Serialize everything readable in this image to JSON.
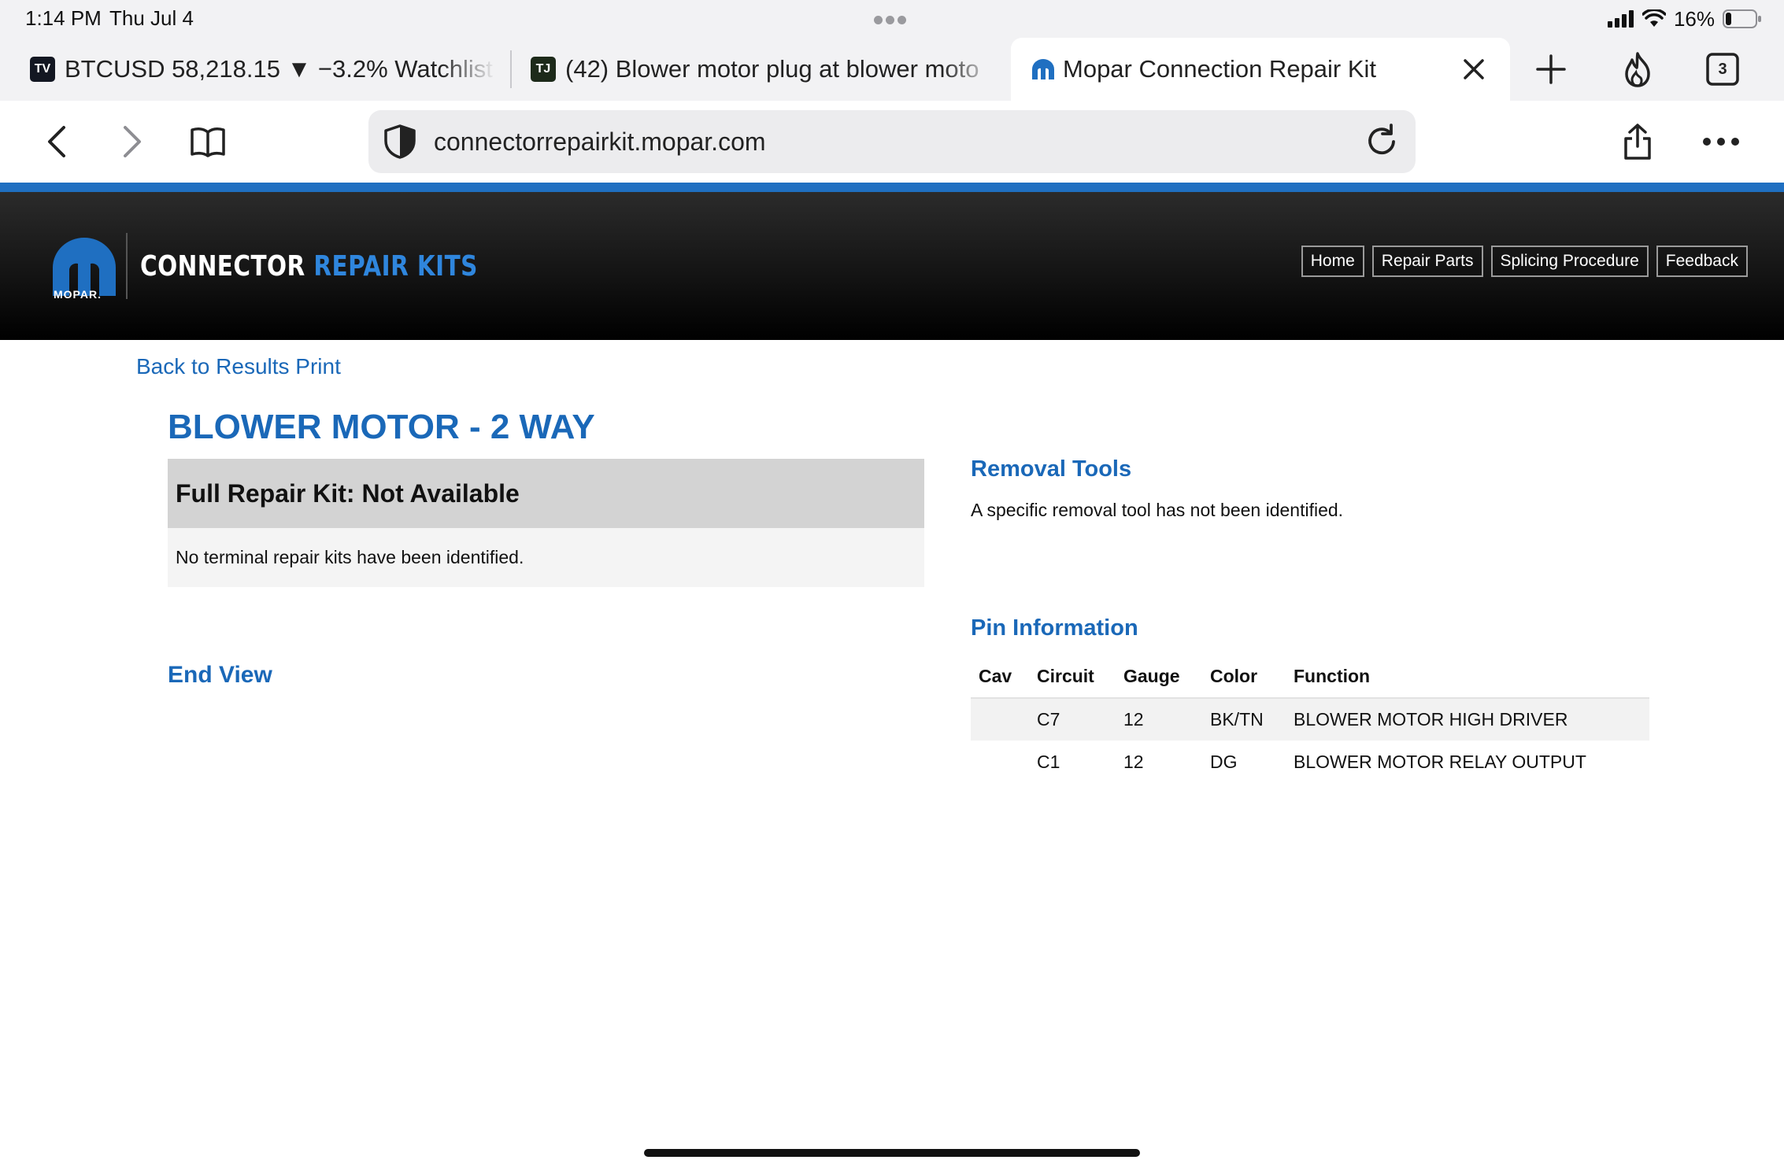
{
  "status_bar": {
    "time": "1:14 PM",
    "date": "Thu Jul 4",
    "battery_percent": "16%",
    "icons": [
      "signal-icon",
      "wifi-icon",
      "battery-icon"
    ]
  },
  "tabs": [
    {
      "favicon": "TV",
      "label": "BTCUSD 58,218.15 ▼ −3.2% Watchlist"
    },
    {
      "favicon": "TJ",
      "label": "(42) Blower motor plug at blower moto"
    },
    {
      "favicon": "mopar-icon",
      "label": "Mopar Connection Repair Kit",
      "active": true
    }
  ],
  "tab_bar": {
    "tab_count": "3",
    "icons": [
      "close-icon",
      "plus-icon",
      "flame-icon",
      "tabs-icon"
    ]
  },
  "toolbar": {
    "url": "connectorrepairkit.mopar.com",
    "icons": [
      "back-icon",
      "forward-icon",
      "bookmarks-icon",
      "shield-icon",
      "reload-icon",
      "share-icon",
      "more-icon"
    ]
  },
  "site": {
    "logo_word": "MOPAR.",
    "brand_word1": "CONNECTOR",
    "brand_word2": "REPAIR KITS",
    "brand_color": "#2f86dd",
    "nav": [
      "Home",
      "Repair Parts",
      "Splicing Procedure",
      "Feedback"
    ]
  },
  "content": {
    "back_link": "Back to Results Print",
    "title": "BLOWER MOTOR - 2 WAY",
    "kit_heading": "Full Repair Kit: Not Available",
    "kit_body": "No terminal repair kits have been identified.",
    "end_view_heading": "End View",
    "removal_heading": "Removal Tools",
    "removal_text": "A specific removal tool has not been identified.",
    "pin_heading": "Pin Information",
    "accent_color": "#1a68b8"
  },
  "pin_table": {
    "headers": [
      "Cav",
      "Circuit",
      "Gauge",
      "Color",
      "Function"
    ],
    "rows": [
      [
        "",
        "C7",
        "12",
        "BK/TN",
        "BLOWER MOTOR HIGH DRIVER"
      ],
      [
        "",
        "C1",
        "12",
        "DG",
        "BLOWER MOTOR RELAY OUTPUT"
      ]
    ]
  }
}
